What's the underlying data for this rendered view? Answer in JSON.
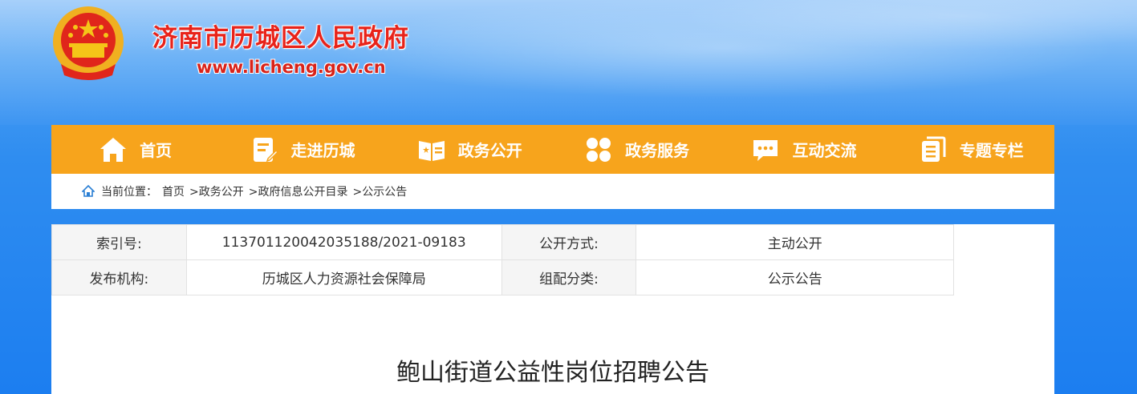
{
  "header": {
    "site_title": "济南市历城区人民政府",
    "site_url": "www.licheng.gov.cn"
  },
  "nav": {
    "items": [
      {
        "label": "首页",
        "icon": "home-icon"
      },
      {
        "label": "走进历城",
        "icon": "document-edit-icon"
      },
      {
        "label": "政务公开",
        "icon": "open-book-icon"
      },
      {
        "label": "政务服务",
        "icon": "service-circles-icon"
      },
      {
        "label": "互动交流",
        "icon": "chat-bubble-icon"
      },
      {
        "label": "专题专栏",
        "icon": "column-pages-icon"
      }
    ]
  },
  "breadcrumb": {
    "prefix": "当前位置：",
    "items": [
      "首页",
      ">政务公开",
      ">政府信息公开目录",
      ">公示公告"
    ]
  },
  "meta": {
    "index_label": "索引号:",
    "index_value": "11370112004203518 8/2021-09183",
    "index_value_exact": "113701120042035188/2021-09183",
    "publish_mode_label": "公开方式:",
    "publish_mode_value": "主动公开",
    "org_label": "发布机构:",
    "org_value": "历城区人力资源社会保障局",
    "category_label": "组配分类:",
    "category_value": "公示公告"
  },
  "article": {
    "title": "鲍山街道公益性岗位招聘公告"
  },
  "colors": {
    "nav_bg": "#f7a41c",
    "title_red": "#e8231a"
  }
}
